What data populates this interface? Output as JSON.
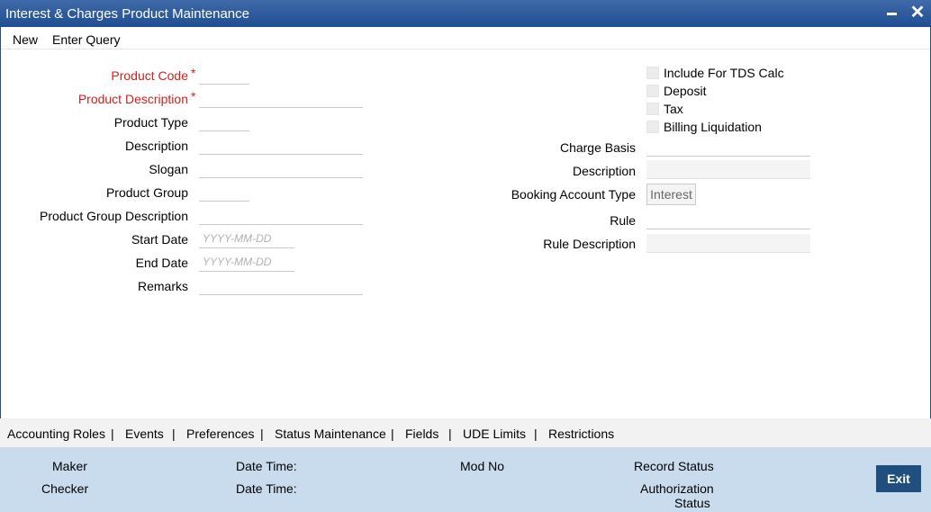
{
  "window": {
    "title": "Interest & Charges Product Maintenance",
    "minimize_label": "",
    "close_label": "✕"
  },
  "menu": {
    "new": "New",
    "enter_query": "Enter Query"
  },
  "form_left": {
    "product_code": "Product Code",
    "product_description": "Product Description",
    "required_marker": "*",
    "product_type": "Product Type",
    "description": "Description",
    "slogan": "Slogan",
    "product_group": "Product Group",
    "product_group_description": "Product Group Description",
    "start_date": "Start Date",
    "end_date": "End Date",
    "remarks": "Remarks",
    "date_placeholder": "YYYY-MM-DD"
  },
  "form_right": {
    "include_tds": "Include For TDS Calc",
    "deposit": "Deposit",
    "tax": "Tax",
    "billing_liquidation": "Billing Liquidation",
    "charge_basis": "Charge Basis",
    "description": "Description",
    "booking_account_type": "Booking Account Type",
    "booking_account_value": "Interest",
    "rule": "Rule",
    "rule_description": "Rule Description"
  },
  "tabs": [
    "Accounting Roles",
    "Events",
    "Preferences",
    "Status Maintenance",
    "Fields",
    "UDE Limits",
    "Restrictions"
  ],
  "tab_separator": "|",
  "audit": {
    "maker": "Maker",
    "checker": "Checker",
    "date_time": "Date Time:",
    "mod_no": "Mod No",
    "record_status": "Record Status",
    "authorization": "Authorization",
    "status": "Status",
    "exit": "Exit"
  },
  "colors": {
    "title_bar": "#204e92",
    "required": "#d0211d",
    "audit_bg": "#c9dced",
    "exit_button": "#1f4e7f"
  }
}
